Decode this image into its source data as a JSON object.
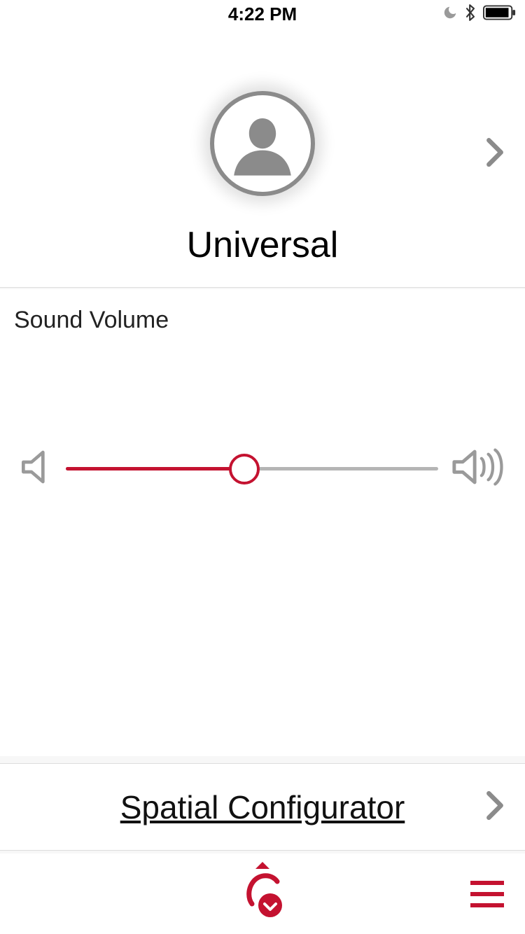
{
  "status": {
    "time": "4:22 PM",
    "icons": {
      "moon": "moon-icon",
      "bluetooth": "bluetooth-icon",
      "battery": "battery-icon"
    }
  },
  "profile": {
    "name": "Universal"
  },
  "volume": {
    "label": "Sound Volume",
    "value_percent": 48
  },
  "spatial": {
    "label": "Spatial Configurator"
  },
  "colors": {
    "accent": "#c41230",
    "grey": "#8b8b8b"
  }
}
